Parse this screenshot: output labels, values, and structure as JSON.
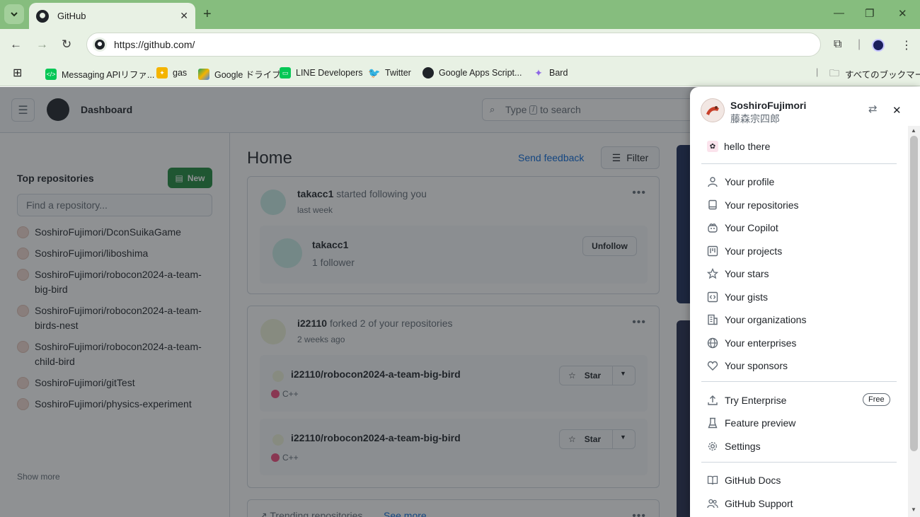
{
  "browser": {
    "tab_title": "GitHub",
    "url": "https://github.com/",
    "bookmarks": [
      {
        "label": "Messaging APIリファ...",
        "icon": "line-green-icon",
        "color": "#06c755"
      },
      {
        "label": "gas",
        "icon": "gas-icon",
        "color": "#f4b400"
      },
      {
        "label": "Google ドライブ",
        "icon": "google-drive-icon",
        "color": "#1fa463"
      },
      {
        "label": "LINE Developers",
        "icon": "line-icon",
        "color": "#06c755"
      },
      {
        "label": "Twitter",
        "icon": "twitter-icon",
        "color": "#1d9bf0"
      },
      {
        "label": "Google Apps Script...",
        "icon": "github-icon",
        "color": "#1f2328"
      },
      {
        "label": "Bard",
        "icon": "bard-icon",
        "color": "#8e67e6"
      }
    ],
    "all_bookmarks_label": "すべてのブックマーク"
  },
  "header": {
    "context": "Dashboard",
    "search_prefix": "Type",
    "search_key": "/",
    "search_suffix": "to search"
  },
  "sidebar": {
    "title": "Top repositories",
    "new_label": "New",
    "find_placeholder": "Find a repository...",
    "repos": [
      "SoshiroFujimori/DconSuikaGame",
      "SoshiroFujimori/liboshima",
      "SoshiroFujimori/robocon2024-a-team-big-bird",
      "SoshiroFujimori/robocon2024-a-team-birds-nest",
      "SoshiroFujimori/robocon2024-a-team-child-bird",
      "SoshiroFujimori/gitTest",
      "SoshiroFujimori/physics-experiment"
    ],
    "show_more": "Show more"
  },
  "feed": {
    "title": "Home",
    "send_feedback": "Send feedback",
    "filter": "Filter",
    "card1": {
      "user": "takacc1",
      "action": "started following you",
      "time": "last week",
      "target_user": "takacc1",
      "followers": "1 follower",
      "unfollow": "Unfollow"
    },
    "card2": {
      "user": "i22110",
      "action": "forked 2 of your repositories",
      "time": "2 weeks ago",
      "repos": [
        {
          "name": "i22110/robocon2024-a-team-big-bird",
          "lang": "C++",
          "star": "Star"
        },
        {
          "name": "i22110/robocon2024-a-team-big-bird",
          "lang": "C++",
          "star": "Star"
        }
      ]
    },
    "card3_partial": "Trending repositories",
    "card3_link": "See more"
  },
  "user_menu": {
    "login": "SoshiroFujimori",
    "name": "藤森宗四郎",
    "status": "hello there",
    "items_group1": [
      {
        "label": "Your profile",
        "icon": "person-icon"
      },
      {
        "label": "Your repositories",
        "icon": "repo-icon"
      },
      {
        "label": "Your Copilot",
        "icon": "copilot-icon"
      },
      {
        "label": "Your projects",
        "icon": "project-icon"
      },
      {
        "label": "Your stars",
        "icon": "star-icon"
      },
      {
        "label": "Your gists",
        "icon": "code-square-icon"
      },
      {
        "label": "Your organizations",
        "icon": "organization-icon"
      },
      {
        "label": "Your enterprises",
        "icon": "globe-icon"
      },
      {
        "label": "Your sponsors",
        "icon": "heart-icon"
      }
    ],
    "items_group2": [
      {
        "label": "Try Enterprise",
        "icon": "upload-icon"
      },
      {
        "label": "Feature preview",
        "icon": "beaker-icon"
      },
      {
        "label": "Settings",
        "icon": "gear-icon"
      }
    ],
    "free_badge": "Free",
    "items_group3": [
      {
        "label": "GitHub Docs",
        "icon": "book-icon"
      },
      {
        "label": "GitHub Support",
        "icon": "people-icon"
      }
    ]
  }
}
